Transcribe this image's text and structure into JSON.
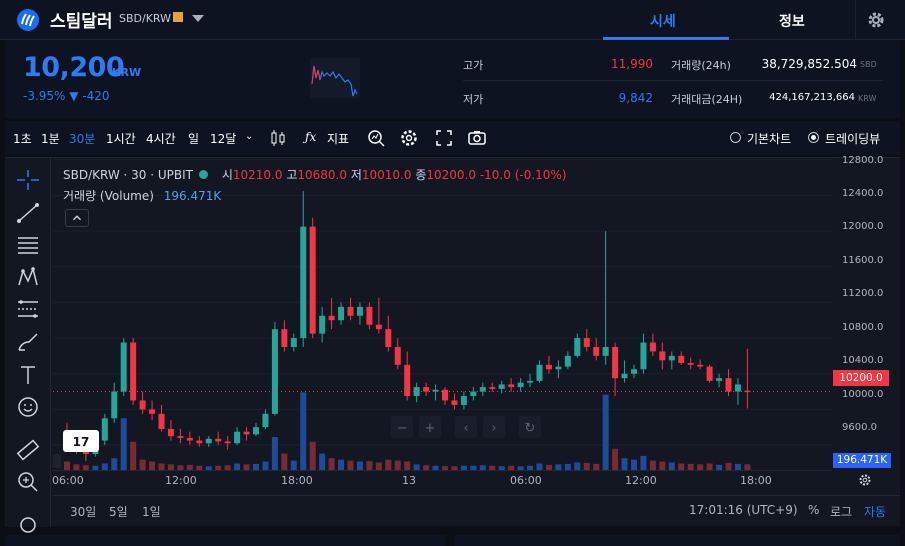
{
  "header": {
    "coin_name": "스팀달러",
    "pair": "SBD/KRW",
    "tabs": [
      {
        "label": "시세",
        "active": true
      },
      {
        "label": "정보",
        "active": false
      }
    ]
  },
  "ticker": {
    "price": "10,200",
    "unit": "KRW",
    "change_pct": "-3.95%",
    "change_abs": "▼ -420",
    "stats": [
      {
        "label": "고가",
        "value": "11,990",
        "color": "#f23645"
      },
      {
        "label": "저가",
        "value": "9,842",
        "color": "#2f7bf2"
      },
      {
        "label": "거래량(24h)",
        "value": "38,729,852.504",
        "unit": "SBD"
      },
      {
        "label": "거래대금(24H)",
        "value": "424,167,213,664",
        "unit": "KRW"
      }
    ]
  },
  "toolbar": {
    "intervals": [
      "1초",
      "1분",
      "30분",
      "1시간",
      "4시간",
      "일",
      "12달"
    ],
    "active_interval": "30분",
    "indicator_label": "지표",
    "view_basic": "기본차트",
    "view_tv": "트레이딩뷰",
    "selected_view": "트레이딩뷰"
  },
  "chart": {
    "legend_symbol": "SBD/KRW · 30 · UPBIT",
    "open_label": "시",
    "open": "10210.0",
    "high_label": "고",
    "high": "10680.0",
    "low_label": "저",
    "low": "10010.0",
    "close_label": "종",
    "close": "10200.0",
    "change": "-10.0 (-0.10%)",
    "volume_label": "거래량 (Volume)",
    "volume_value": "196.471K",
    "current_price_tag": "10200.0",
    "volume_tag": "196.471K",
    "y_ticks": [
      "12800.0",
      "12400.0",
      "12000.0",
      "11600.0",
      "11200.0",
      "10800.0",
      "10400.0",
      "10000.0",
      "9600.0"
    ],
    "x_ticks": [
      "06:00",
      "12:00",
      "18:00",
      "13",
      "06:00",
      "12:00",
      "18:00"
    ],
    "range_buttons": [
      "30일",
      "5일",
      "1일"
    ],
    "time_display": "17:01:16 (UTC+9)",
    "scale_pct": "%",
    "scale_log": "로그",
    "scale_auto": "자동",
    "logo_text": "17"
  },
  "chart_data": {
    "type": "candlestick",
    "ylim": [
      9320,
      12820
    ],
    "up_color": "#26a69a",
    "down_color": "#f23645",
    "candles": [
      [
        9700,
        9850,
        9580,
        9620
      ],
      [
        9620,
        9720,
        9500,
        9560
      ],
      [
        9560,
        9620,
        9420,
        9500
      ],
      [
        9500,
        9700,
        9470,
        9650
      ],
      [
        9650,
        9950,
        9600,
        9900
      ],
      [
        9900,
        10300,
        9850,
        10200
      ],
      [
        10200,
        10800,
        10150,
        10750
      ],
      [
        10750,
        10800,
        10050,
        10100
      ],
      [
        10100,
        10200,
        9950,
        10000
      ],
      [
        10000,
        10100,
        9880,
        9950
      ],
      [
        9950,
        10050,
        9750,
        9780
      ],
      [
        9780,
        9880,
        9650,
        9700
      ],
      [
        9700,
        9780,
        9620,
        9680
      ],
      [
        9680,
        9750,
        9600,
        9650
      ],
      [
        9650,
        9700,
        9580,
        9620
      ],
      [
        9620,
        9700,
        9580,
        9670
      ],
      [
        9670,
        9750,
        9600,
        9640
      ],
      [
        9640,
        9700,
        9550,
        9620
      ],
      [
        9620,
        9800,
        9600,
        9750
      ],
      [
        9750,
        9800,
        9650,
        9720
      ],
      [
        9720,
        9850,
        9700,
        9800
      ],
      [
        9800,
        10000,
        9780,
        9950
      ],
      [
        9950,
        10980,
        9930,
        10900
      ],
      [
        10900,
        11000,
        10650,
        10700
      ],
      [
        10700,
        10850,
        10650,
        10800
      ],
      [
        10800,
        12450,
        10700,
        12050
      ],
      [
        12050,
        12150,
        10800,
        10850
      ],
      [
        10850,
        11150,
        10750,
        11050
      ],
      [
        11050,
        11250,
        10900,
        11000
      ],
      [
        11000,
        11200,
        10950,
        11150
      ],
      [
        11150,
        11250,
        11000,
        11050
      ],
      [
        11050,
        11200,
        10950,
        11150
      ],
      [
        11150,
        11200,
        10900,
        10950
      ],
      [
        10950,
        11250,
        10850,
        10900
      ],
      [
        10900,
        11050,
        10650,
        10700
      ],
      [
        10700,
        10800,
        10450,
        10500
      ],
      [
        10500,
        10650,
        10100,
        10150
      ],
      [
        10150,
        10300,
        10080,
        10250
      ],
      [
        10250,
        10300,
        10150,
        10200
      ],
      [
        10200,
        10280,
        10100,
        10220
      ],
      [
        10220,
        10250,
        10050,
        10100
      ],
      [
        10100,
        10180,
        10000,
        10050
      ],
      [
        10050,
        10200,
        10000,
        10150
      ],
      [
        10150,
        10250,
        10100,
        10200
      ],
      [
        10200,
        10300,
        10150,
        10250
      ],
      [
        10250,
        10300,
        10200,
        10230
      ],
      [
        10230,
        10320,
        10180,
        10280
      ],
      [
        10280,
        10350,
        10200,
        10250
      ],
      [
        10250,
        10350,
        10200,
        10300
      ],
      [
        10300,
        10400,
        10250,
        10320
      ],
      [
        10320,
        10550,
        10300,
        10500
      ],
      [
        10500,
        10600,
        10400,
        10450
      ],
      [
        10450,
        10550,
        10350,
        10480
      ],
      [
        10480,
        10650,
        10450,
        10600
      ],
      [
        10600,
        10850,
        10580,
        10800
      ],
      [
        10800,
        10900,
        10650,
        10700
      ],
      [
        10700,
        10800,
        10550,
        10600
      ],
      [
        10600,
        12000,
        10500,
        10700
      ],
      [
        10700,
        10750,
        10150,
        10350
      ],
      [
        10350,
        10550,
        10300,
        10400
      ],
      [
        10400,
        10500,
        10350,
        10450
      ],
      [
        10450,
        10850,
        10400,
        10750
      ],
      [
        10750,
        10850,
        10600,
        10650
      ],
      [
        10650,
        10750,
        10450,
        10550
      ],
      [
        10550,
        10650,
        10450,
        10600
      ],
      [
        10600,
        10650,
        10500,
        10520
      ],
      [
        10520,
        10580,
        10450,
        10500
      ],
      [
        10500,
        10560,
        10450,
        10480
      ],
      [
        10480,
        10500,
        10300,
        10320
      ],
      [
        10320,
        10400,
        10250,
        10350
      ],
      [
        10350,
        10450,
        10150,
        10200
      ],
      [
        10200,
        10350,
        10050,
        10280
      ],
      [
        10210,
        10680,
        10010,
        10200
      ]
    ],
    "volumes": [
      18,
      12,
      10,
      9,
      14,
      25,
      110,
      60,
      22,
      18,
      14,
      12,
      10,
      11,
      9,
      8,
      9,
      10,
      14,
      12,
      13,
      18,
      70,
      35,
      20,
      165,
      60,
      35,
      25,
      22,
      20,
      18,
      19,
      16,
      22,
      20,
      18,
      12,
      10,
      9,
      8,
      8,
      9,
      9,
      10,
      9,
      8,
      9,
      8,
      9,
      14,
      11,
      12,
      13,
      16,
      15,
      13,
      160,
      45,
      25,
      22,
      30,
      20,
      18,
      16,
      14,
      13,
      12,
      14,
      11,
      15,
      13,
      12
    ],
    "volume_colors": "same-as-candle"
  }
}
